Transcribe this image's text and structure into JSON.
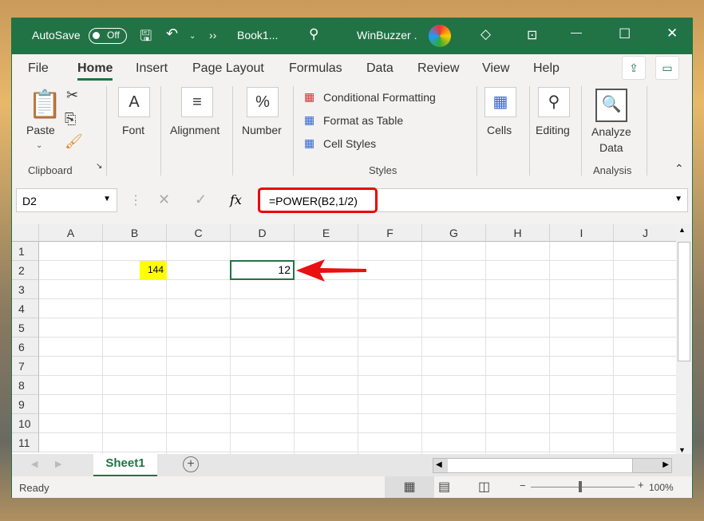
{
  "titlebar": {
    "autosave": "AutoSave",
    "toggle": "Off",
    "more": "››",
    "book": "Book1...",
    "user": "WinBuzzer ."
  },
  "tabs": [
    "File",
    "Home",
    "Insert",
    "Page Layout",
    "Formulas",
    "Data",
    "Review",
    "View",
    "Help"
  ],
  "ribbon": {
    "paste": "Paste",
    "clipboard": "Clipboard",
    "font": "Font",
    "alignment": "Alignment",
    "number": "Number",
    "cond": "Conditional Formatting",
    "fmt_table": "Format as Table",
    "cell_styles": "Cell Styles",
    "styles": "Styles",
    "cells": "Cells",
    "editing": "Editing",
    "analyze1": "Analyze",
    "analyze2": "Data",
    "analysis": "Analysis"
  },
  "formula_bar": {
    "namebox": "D2",
    "formula": "=POWER(B2,1/2)",
    "fx": "fx"
  },
  "columns": [
    "A",
    "B",
    "C",
    "D",
    "E",
    "F",
    "G",
    "H",
    "I",
    "J"
  ],
  "rows": [
    "1",
    "2",
    "3",
    "4",
    "5",
    "6",
    "7",
    "8",
    "9",
    "10",
    "11"
  ],
  "cells": {
    "B2": "144",
    "D2": "12"
  },
  "highlight_color": "#ffff00",
  "sheet_tab": "Sheet1",
  "status": {
    "ready": "Ready",
    "zoom": "100%"
  }
}
